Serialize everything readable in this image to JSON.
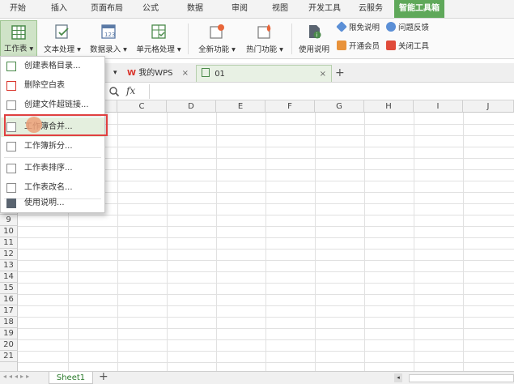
{
  "tabs": [
    "开始",
    "插入",
    "页面布局",
    "公式",
    "数据",
    "审阅",
    "视图",
    "开发工具",
    "云服务",
    "智能工具箱"
  ],
  "ribbon": {
    "buttons": [
      "工作表",
      "文本处理",
      "数据录入",
      "单元格处理",
      "全新功能",
      "热门功能",
      "使用说明"
    ],
    "small": [
      "限免说明",
      "问题反馈",
      "开通会员",
      "关闭工具"
    ]
  },
  "doc_tabs": {
    "wps_label": "我的WPS",
    "file_label": "01",
    "add_icon": "plus-icon"
  },
  "formula_bar": {
    "fx": "fx"
  },
  "columns": [
    "C",
    "D",
    "E",
    "F",
    "G",
    "H",
    "I",
    "J"
  ],
  "rows": [
    "9",
    "10",
    "11",
    "12",
    "13",
    "14",
    "15",
    "16",
    "17",
    "18",
    "19",
    "20",
    "21"
  ],
  "sheet": {
    "name": "Sheet1"
  },
  "menu": {
    "items": [
      "创建表格目录...",
      "删除空白表",
      "创建文件超链接...",
      "工作簿合并...",
      "工作簿拆分...",
      "工作表排序...",
      "工作表改名...",
      "使用说明..."
    ]
  },
  "colors": {
    "accent": "#5fa85a",
    "highlight_box": "#e04040"
  }
}
